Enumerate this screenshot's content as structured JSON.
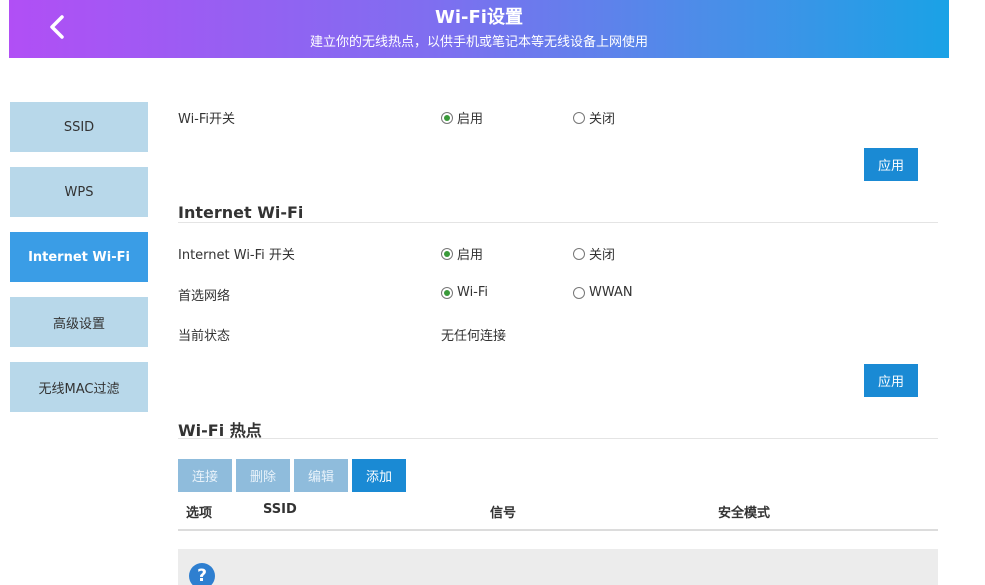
{
  "header": {
    "title": "Wi-Fi设置",
    "subtitle": "建立你的无线热点，以供手机或笔记本等无线设备上网使用"
  },
  "sidebar": {
    "items": [
      {
        "label": "SSID"
      },
      {
        "label": "WPS"
      },
      {
        "label": "Internet Wi-Fi",
        "active": true
      },
      {
        "label": "高级设置"
      },
      {
        "label": "无线MAC过滤"
      }
    ]
  },
  "wifi_switch": {
    "label": "Wi-Fi开关",
    "options": [
      "启用",
      "关闭"
    ],
    "selected": "启用",
    "apply_label": "应用"
  },
  "internet_wifi": {
    "title": "Internet Wi-Fi",
    "switch_label": "Internet Wi-Fi 开关",
    "switch_options": [
      "启用",
      "关闭"
    ],
    "switch_selected": "启用",
    "network_label": "首选网络",
    "network_options": [
      "Wi-Fi",
      "WWAN"
    ],
    "network_selected": "Wi-Fi",
    "status_label": "当前状态",
    "status_value": "无任何连接",
    "apply_label": "应用"
  },
  "hotspot": {
    "title": "Wi-Fi 热点",
    "buttons": {
      "connect": "连接",
      "delete": "删除",
      "edit": "编辑",
      "add": "添加"
    },
    "columns": [
      "选项",
      "SSID",
      "信号",
      "安全模式"
    ]
  },
  "help": {
    "icon_text": "?"
  },
  "colors": {
    "accent": "#1a8ad4",
    "sidebar_bg": "#b8d8ea",
    "sidebar_active": "#3a9de6",
    "header_gradient_start": "#b14ff5",
    "header_gradient_end": "#1aa2e6"
  }
}
